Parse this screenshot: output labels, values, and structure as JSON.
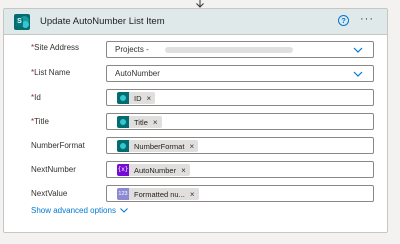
{
  "card": {
    "title": "Update AutoNumber List Item",
    "help_glyph": "?",
    "more_glyph": "···"
  },
  "fields": {
    "site_address": {
      "label": "Site Address",
      "required": true,
      "value": "Projects -"
    },
    "list_name": {
      "label": "List Name",
      "required": true,
      "value": "AutoNumber"
    },
    "id": {
      "label": "Id",
      "required": true,
      "token": "ID"
    },
    "title": {
      "label": "Title",
      "required": true,
      "token": "Title"
    },
    "number_format": {
      "label": "NumberFormat",
      "required": false,
      "token": "NumberFormat"
    },
    "next_number": {
      "label": "NextNumber",
      "required": false,
      "token": "AutoNumber",
      "icon_text": "{x}"
    },
    "next_value": {
      "label": "NextValue",
      "required": false,
      "token": "Formatted nu...",
      "icon_text": "123"
    }
  },
  "token_remove_glyph": "×",
  "required_mark": "*",
  "show_advanced": "Show advanced options",
  "colors": {
    "header_bg": "#dfe9ea",
    "accent": "#0078d4",
    "sharepoint": "#036c70",
    "variable": "#770bd6",
    "expression": "#8c8ad3",
    "required": "#a4262c"
  }
}
